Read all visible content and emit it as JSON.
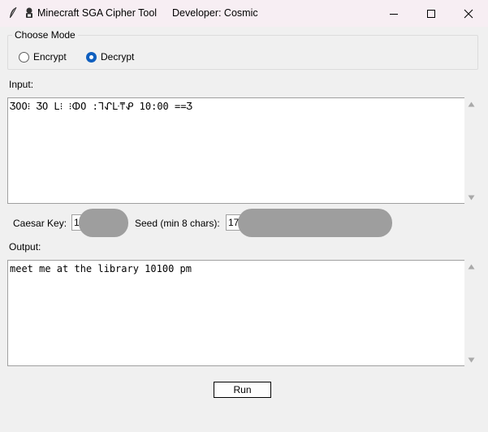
{
  "window": {
    "title": "Minecraft SGA Cipher Tool",
    "developer_label": "Developer: Cosmic"
  },
  "mode": {
    "legend": "Choose Mode",
    "options": [
      {
        "label": "Encrypt",
        "selected": false
      },
      {
        "label": "Decrypt",
        "selected": true
      }
    ]
  },
  "input": {
    "label": "Input:",
    "value": "ƷOO⁝ ƷO L⁝ ⁝ⵀO :ᒣᖋᒷ⍑ᕵ 10:00 ==Ʒ"
  },
  "keys": {
    "caesar_label": "Caesar Key:",
    "caesar_value": "1",
    "seed_label": "Seed (min 8 chars):",
    "seed_value": "17"
  },
  "output": {
    "label": "Output:",
    "value": "meet me at the library 10100 pm"
  },
  "actions": {
    "run_label": "Run"
  },
  "colors": {
    "accent": "#0f5fbf",
    "titlebar": "#f7eef3",
    "window_bg": "#f0f0f0",
    "redaction": "#9e9e9e"
  }
}
